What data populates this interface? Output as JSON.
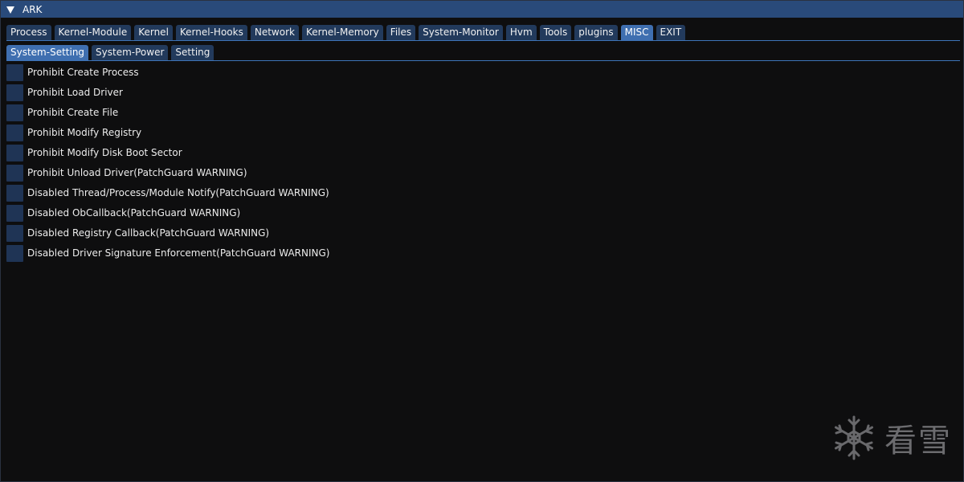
{
  "window": {
    "title": "ARK"
  },
  "main_tabs": [
    {
      "label": "Process",
      "active": false
    },
    {
      "label": "Kernel-Module",
      "active": false
    },
    {
      "label": "Kernel",
      "active": false
    },
    {
      "label": "Kernel-Hooks",
      "active": false
    },
    {
      "label": "Network",
      "active": false
    },
    {
      "label": "Kernel-Memory",
      "active": false
    },
    {
      "label": "Files",
      "active": false
    },
    {
      "label": "System-Monitor",
      "active": false
    },
    {
      "label": "Hvm",
      "active": false
    },
    {
      "label": "Tools",
      "active": false
    },
    {
      "label": "plugins",
      "active": false
    },
    {
      "label": "MISC",
      "active": true
    },
    {
      "label": "EXIT",
      "active": false
    }
  ],
  "sub_tabs": [
    {
      "label": "System-Setting",
      "active": true
    },
    {
      "label": "System-Power",
      "active": false
    },
    {
      "label": "Setting",
      "active": false
    }
  ],
  "options": [
    {
      "label": "Prohibit Create Process",
      "checked": false
    },
    {
      "label": "Prohibit Load Driver",
      "checked": false
    },
    {
      "label": "Prohibit Create File",
      "checked": false
    },
    {
      "label": "Prohibit Modify Registry",
      "checked": false
    },
    {
      "label": "Prohibit Modify Disk Boot Sector",
      "checked": false
    },
    {
      "label": "Prohibit Unload Driver(PatchGuard WARNING)",
      "checked": false
    },
    {
      "label": "Disabled Thread/Process/Module Notify(PatchGuard WARNING)",
      "checked": false
    },
    {
      "label": "Disabled ObCallback(PatchGuard WARNING)",
      "checked": false
    },
    {
      "label": "Disabled Registry Callback(PatchGuard WARNING)",
      "checked": false
    },
    {
      "label": "Disabled Driver Signature Enforcement(PatchGuard WARNING)",
      "checked": false
    }
  ],
  "watermark": {
    "text": "看雪",
    "icon": "snowflake-icon"
  },
  "colors": {
    "titlebar": "#294a7a",
    "tab": "#223a5c",
    "tab_active": "#3f6fb0",
    "checkbox": "#1f3455",
    "background": "#0e0e0f"
  }
}
